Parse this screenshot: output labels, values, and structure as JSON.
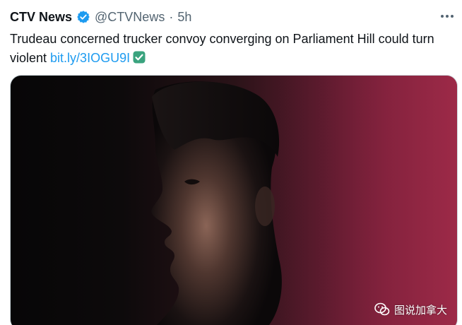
{
  "account": {
    "name": "CTV News",
    "handle": "@CTVNews",
    "separator": "·",
    "time": "5h"
  },
  "more_icon": "more-dots-icon",
  "tweet": {
    "text": "Trudeau concerned trucker convoy converging on Parliament Hill could turn violent ",
    "link": "bit.ly/3IOGU9I",
    "emoji_icon": "check-mark-button-icon"
  },
  "media": {
    "watermark": "图说加拿大",
    "watermark_icon": "wechat-icon"
  },
  "colors": {
    "verified": "#1d9bf0",
    "link": "#1d9bf0",
    "checkmark_emoji": "#3aa37e"
  }
}
